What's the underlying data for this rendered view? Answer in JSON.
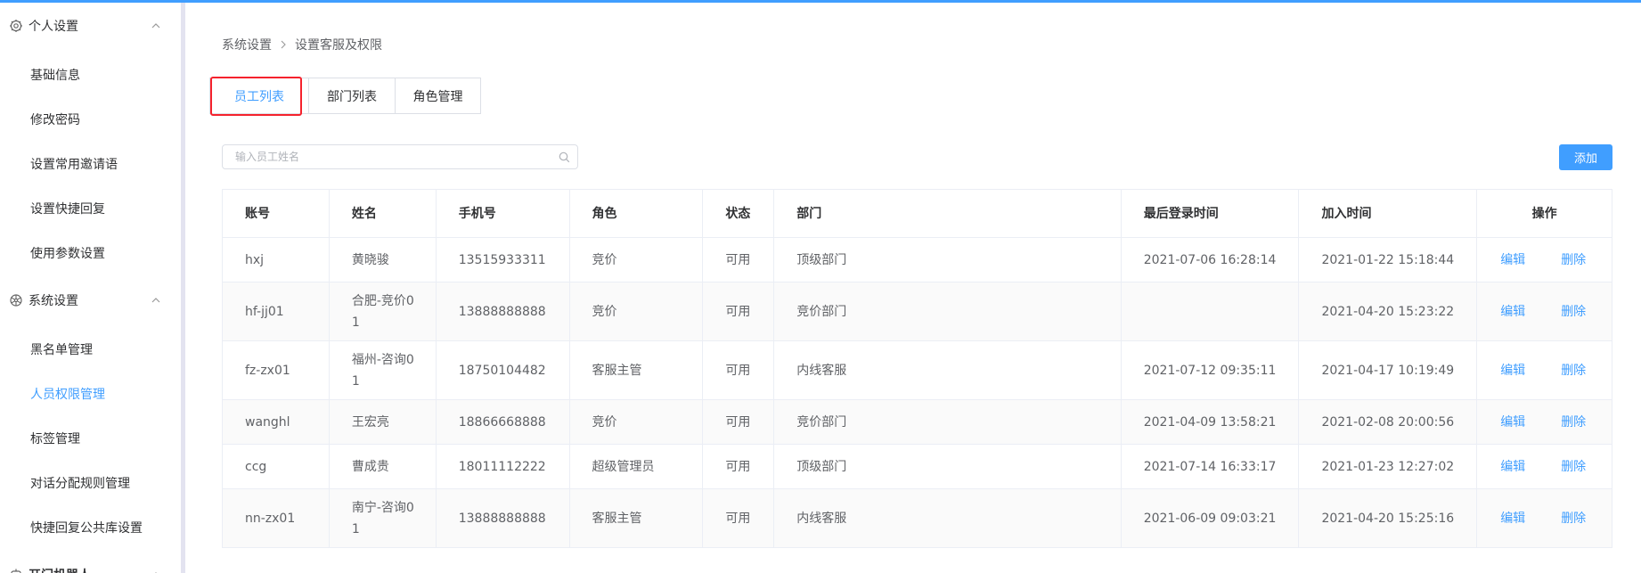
{
  "sidebar": {
    "groups": [
      {
        "label": "个人设置",
        "icon": "gear-icon",
        "items": [
          "基础信息",
          "修改密码",
          "设置常用邀请语",
          "设置快捷回复",
          "使用参数设置"
        ]
      },
      {
        "label": "系统设置",
        "icon": "settings-wheel-icon",
        "items": [
          "黑名单管理",
          "人员权限管理",
          "标签管理",
          "对话分配规则管理",
          "快捷回复公共库设置"
        ]
      },
      {
        "label": "开门机器人",
        "icon": "robot-icon",
        "items": []
      }
    ],
    "active_item": "人员权限管理"
  },
  "breadcrumb": {
    "root": "系统设置",
    "current": "设置客服及权限"
  },
  "tabs": [
    "员工列表",
    "部门列表",
    "角色管理"
  ],
  "active_tab": "员工列表",
  "search": {
    "placeholder": "输入员工姓名",
    "value": ""
  },
  "add_label": "添加",
  "table": {
    "columns": [
      "账号",
      "姓名",
      "手机号",
      "角色",
      "状态",
      "部门",
      "最后登录时间",
      "加入时间",
      "操作"
    ],
    "edit_label": "编辑",
    "delete_label": "删除",
    "rows": [
      [
        "hxj",
        "黄晓骏",
        "13515933311",
        "竞价",
        "可用",
        "顶级部门",
        "2021-07-06 16:28:14",
        "2021-01-22 15:18:44"
      ],
      [
        "hf-jj01",
        "合肥-竞价01",
        "13888888888",
        "竞价",
        "可用",
        "竞价部门",
        "",
        "2021-04-20 15:23:22"
      ],
      [
        "fz-zx01",
        "福州-咨询01",
        "18750104482",
        "客服主管",
        "可用",
        "内线客服",
        "2021-07-12 09:35:11",
        "2021-04-17 10:19:49"
      ],
      [
        "wanghl",
        "王宏亮",
        "18866668888",
        "竞价",
        "可用",
        "竞价部门",
        "2021-04-09 13:58:21",
        "2021-02-08 20:00:56"
      ],
      [
        "ccg",
        "曹成贵",
        "18011112222",
        "超级管理员",
        "可用",
        "顶级部门",
        "2021-07-14 16:33:17",
        "2021-01-23 12:27:02"
      ],
      [
        "nn-zx01",
        "南宁-咨询01",
        "13888888888",
        "客服主管",
        "可用",
        "内线客服",
        "2021-06-09 09:03:21",
        "2021-04-20 15:25:16"
      ]
    ]
  },
  "colors": {
    "accent": "#409eff",
    "highlight": "#f5222d"
  }
}
